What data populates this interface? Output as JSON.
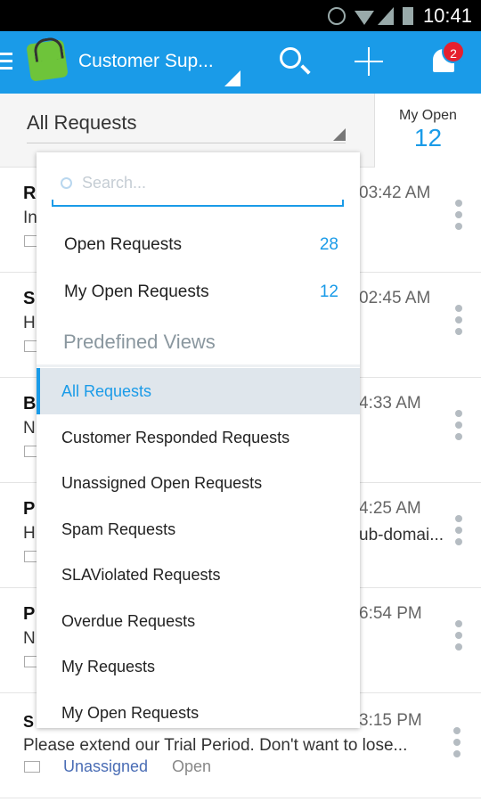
{
  "status_bar": {
    "time": "10:41"
  },
  "header": {
    "title": "Customer Sup...",
    "notification_count": "2",
    "brand_color": "#1a9be8"
  },
  "subheader": {
    "view": "All Requests",
    "my_open_label": "My Open",
    "my_open_count": "12"
  },
  "rows": [
    {
      "name": "R",
      "subject": "In",
      "time": "03:42 AM"
    },
    {
      "name": "S",
      "subject": "H",
      "time": "02:45 AM"
    },
    {
      "name": "B",
      "subject": "N",
      "time": "4:33 AM"
    },
    {
      "name": "P",
      "subject": "H",
      "subject_tail": "ub-domai...",
      "time": "4:25 AM"
    },
    {
      "name": "P",
      "subject": "N",
      "time": "6:54 PM"
    },
    {
      "name": "S",
      "subject": "Please extend our Trial Period. Don't want to lose...",
      "time": "3:15 PM",
      "assignee": "Unassigned",
      "status": "Open"
    }
  ],
  "dropdown": {
    "search_placeholder": "Search...",
    "quick": [
      {
        "label": "Open Requests",
        "count": "28"
      },
      {
        "label": "My Open Requests",
        "count": "12"
      }
    ],
    "section": "Predefined Views",
    "views": [
      "All Requests",
      "Customer Responded Requests",
      "Unassigned Open Requests",
      "Spam Requests",
      "SLAViolated Requests",
      "Overdue Requests",
      "My Requests",
      "My Open Requests"
    ],
    "selected": "All Requests"
  }
}
